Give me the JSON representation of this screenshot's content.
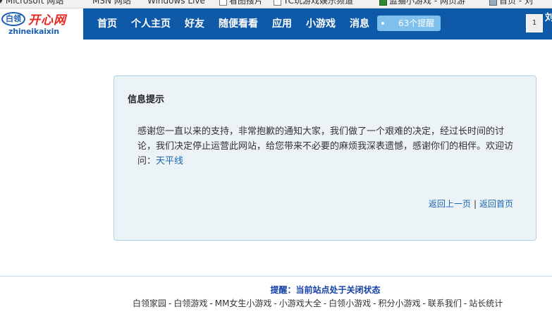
{
  "browser": {
    "favorites": [
      {
        "label": "Microsoft 网站",
        "icon": "page-icon"
      },
      {
        "label": "MSN 网站",
        "icon": "page-icon"
      },
      {
        "label": "Windows Live",
        "icon": "page-icon"
      },
      {
        "label": "看图搜片",
        "icon": "page-icon"
      },
      {
        "label": "TC玩游戏娱乐频道",
        "icon": "page-icon"
      },
      {
        "label": "蓝猫小游戏 - 网页游",
        "icon": "game-icon"
      },
      {
        "label": "首页 - 刘",
        "icon": "home-icon"
      }
    ]
  },
  "header": {
    "logo": {
      "badge": "白领",
      "title": "开心网",
      "subtitle": "zhineikaixin"
    },
    "nav": [
      "首页",
      "个人主页",
      "好友",
      "随便看看",
      "应用",
      "小游戏",
      "消息"
    ],
    "notification": "63个提醒",
    "user": {
      "avatar_text": "1",
      "name": "刘"
    }
  },
  "message": {
    "title": "信息提示",
    "body": "感谢您一直以来的支持，非常抱歉的通知大家，我们做了一个艰难的决定，经过长时间的讨论，我们决定停止运营此网站，给您带来不必要的麻烦我深表遗憾，感谢你们的相伴。欢迎访问：",
    "visit_link": "天平线",
    "back_link": "返回上一页",
    "separator": "|",
    "home_link": "返回首页"
  },
  "footer": {
    "notice": "提醒：当前站点处于关闭状态",
    "links": [
      "白领家园",
      "白领游戏",
      "MM女生小游戏",
      "小游戏大全",
      "白领小游戏",
      "积分小游戏",
      "联系我们",
      "站长统计"
    ],
    "separator": "-"
  },
  "colors": {
    "nav_bg": "#0f5aa8",
    "notify_bg": "#7fc0ec",
    "msgbox_bg": "#ecf3f7",
    "msgbox_border": "#a9d0e7",
    "link": "#1a66b4",
    "notice": "#1440a8"
  }
}
